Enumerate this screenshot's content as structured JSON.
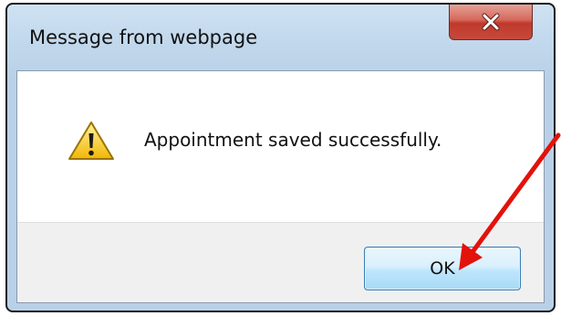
{
  "dialog": {
    "title": "Message from webpage",
    "message": "Appointment saved successfully.",
    "ok_label": "OK"
  },
  "icons": {
    "close": "close-icon",
    "warning": "warning-icon",
    "annotation": "red-arrow-icon"
  },
  "colors": {
    "close_button": "#c0392b",
    "annotation_arrow": "#e3120b",
    "warning_fill": "#f7c71b",
    "ok_border": "#3c7fb1"
  }
}
